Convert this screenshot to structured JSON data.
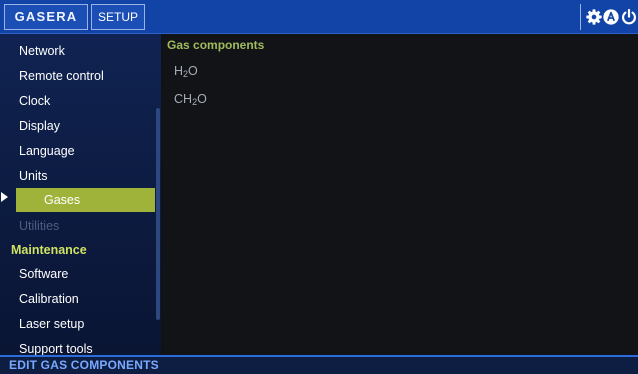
{
  "header": {
    "logo_text": "GASERA",
    "tab_label": "SETUP",
    "icons": [
      "gear-icon",
      "a-circle-icon",
      "power-icon"
    ]
  },
  "sidebar": {
    "items": [
      {
        "label": "Network",
        "state": "normal"
      },
      {
        "label": "Remote control",
        "state": "normal"
      },
      {
        "label": "Clock",
        "state": "normal"
      },
      {
        "label": "Display",
        "state": "normal"
      },
      {
        "label": "Language",
        "state": "normal"
      },
      {
        "label": "Units",
        "state": "normal"
      },
      {
        "label": "Gases",
        "state": "selected"
      },
      {
        "label": "Utilities",
        "state": "disabled"
      }
    ],
    "section_label": "Maintenance",
    "maintenance_items": [
      {
        "label": "Software"
      },
      {
        "label": "Calibration"
      },
      {
        "label": "Laser setup"
      },
      {
        "label": "Support tools"
      }
    ]
  },
  "main": {
    "title": "Gas components",
    "gases": [
      {
        "base": "H",
        "sub": "2",
        "tail": "O"
      },
      {
        "base": "CH",
        "sub": "2",
        "tail": "O"
      }
    ]
  },
  "status_bar": {
    "text": "EDIT GAS COMPONENTS"
  },
  "colors": {
    "topbar": "#1244a8",
    "selected": "#9fb33a",
    "section": "#cfe363",
    "title": "#a0bb5d"
  }
}
